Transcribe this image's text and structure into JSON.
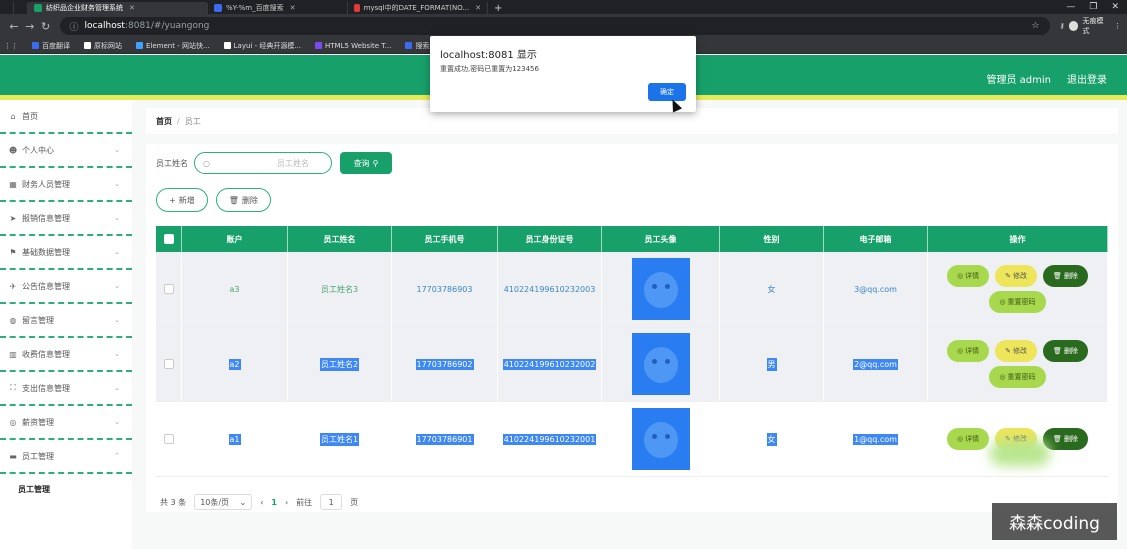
{
  "browser": {
    "tabs": [
      {
        "title": "",
        "color": "#5f6368"
      },
      {
        "title": "",
        "color": "#18a06a"
      },
      {
        "title": "纺织品企业财务管理系统",
        "color": "#18a06a",
        "active": true
      },
      {
        "title": "%Y-%m_百度搜索",
        "color": "#3b6cf0"
      },
      {
        "title": "mysql中的DATE_FORMAT(NO...",
        "color": "#e53935"
      }
    ],
    "url_host": "localhost",
    "url_rest": ":8081/#/yuangong",
    "profile_label": "无痕模式",
    "bookmarks": [
      {
        "label": "百度翻译",
        "color": "#3b6cf0"
      },
      {
        "label": "原标网站",
        "color": "#ffffff"
      },
      {
        "label": "Element - 网站快...",
        "color": "#40a0ff"
      },
      {
        "label": "Layui - 经典开源模...",
        "color": "#ffffff"
      },
      {
        "label": "HTML5 Website T...",
        "color": "#7a4cf0"
      },
      {
        "label": "搜索壁纸",
        "color": "#3b6cf0"
      }
    ]
  },
  "header": {
    "user_label": "管理员 admin",
    "logout_label": "退出登录"
  },
  "sidebar": {
    "items": [
      {
        "label": "首页",
        "icon": "home-icon",
        "glyph": "⌂",
        "chevron": false
      },
      {
        "label": "个人中心",
        "icon": "user-icon",
        "glyph": "☻",
        "chevron": true
      },
      {
        "label": "财务人员管理",
        "icon": "grid-icon",
        "glyph": "▦",
        "chevron": true
      },
      {
        "label": "报销信息管理",
        "icon": "send-icon",
        "glyph": "➤",
        "chevron": true
      },
      {
        "label": "基础数据管理",
        "icon": "flag-icon",
        "glyph": "⚑",
        "chevron": true
      },
      {
        "label": "公告信息管理",
        "icon": "plane-icon",
        "glyph": "✈",
        "chevron": true
      },
      {
        "label": "留言管理",
        "icon": "mic-icon",
        "glyph": "◍",
        "chevron": true
      },
      {
        "label": "收费信息管理",
        "icon": "chart-icon",
        "glyph": "▥",
        "chevron": true
      },
      {
        "label": "支出信息管理",
        "icon": "frame-icon",
        "glyph": "⛶",
        "chevron": true
      },
      {
        "label": "薪资管理",
        "icon": "coin-icon",
        "glyph": "◎",
        "chevron": true
      },
      {
        "label": "员工管理",
        "icon": "monitor-icon",
        "glyph": "▬",
        "chevron": true,
        "open": true
      }
    ],
    "sub_item": "员工管理"
  },
  "breadcrumb": {
    "home": "首页",
    "separator": "/",
    "current": "员工"
  },
  "search": {
    "label": "员工姓名",
    "placeholder": "员工姓名",
    "button_label": "查询"
  },
  "actions": {
    "add_label": "新增",
    "delete_label": "删除"
  },
  "table": {
    "headers": [
      "账户",
      "员工姓名",
      "员工手机号",
      "员工身份证号",
      "员工头像",
      "性别",
      "电子邮箱",
      "操作"
    ],
    "rows": [
      {
        "account": "a3",
        "name": "员工姓名3",
        "phone": "17703786903",
        "idcard": "410224199610232003",
        "gender": "女",
        "email": "3@qq.com",
        "selected": false
      },
      {
        "account": "a2",
        "name": "员工姓名2",
        "phone": "17703786902",
        "idcard": "410224199610232002",
        "gender": "男",
        "email": "2@qq.com",
        "selected": true
      },
      {
        "account": "a1",
        "name": "员工姓名1",
        "phone": "17703786901",
        "idcard": "410224199610232001",
        "gender": "女",
        "email": "1@qq.com",
        "selected": true
      }
    ],
    "op_labels": {
      "detail": "详情",
      "edit": "修改",
      "delete": "删除",
      "reset": "重置密码"
    }
  },
  "pagination": {
    "total": "共 3 条",
    "page_size": "10条/页",
    "prev": "‹",
    "current_page": "1",
    "next": "›",
    "goto_label": "前往",
    "goto_value": "1",
    "page_suffix": "页"
  },
  "alert": {
    "title": "localhost:8081 显示",
    "message": "重置成功,密码已重置为123456",
    "ok_label": "确定"
  },
  "watermark": "森森coding"
}
